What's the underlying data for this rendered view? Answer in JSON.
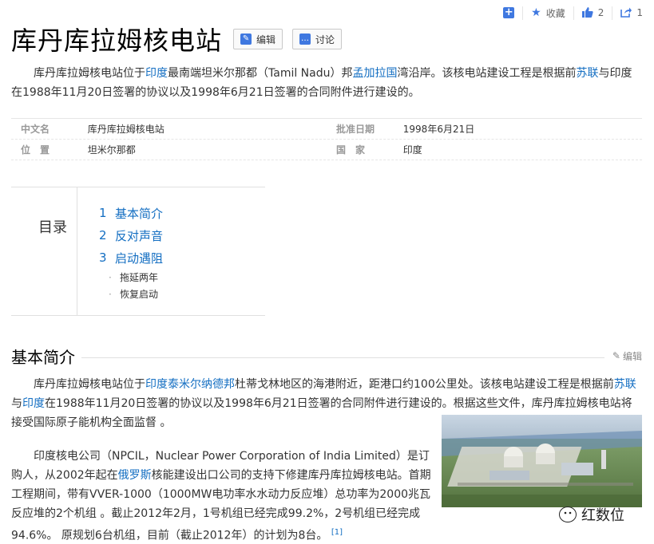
{
  "topbar": {
    "collect_label": "收藏",
    "like_count": "2",
    "share_count": "1"
  },
  "header": {
    "title": "库丹库拉姆核电站",
    "edit_label": "编辑",
    "discuss_label": "讨论"
  },
  "intro": {
    "s1": "库丹库拉姆核电站位于",
    "l1": "印度",
    "s2": "最南端坦米尔那都（Tamil Nadu）邦",
    "l2": "孟加拉国",
    "s3": "湾沿岸。该核电站建设工程是根据前",
    "l3": "苏联",
    "s4": "与印度在1988年11月20日签署的协议以及1998年6月21日签署的合同附件进行建设的。"
  },
  "basic_info": [
    {
      "n1": "中文名",
      "v1": "库丹库拉姆核电站",
      "n2": "批准日期",
      "v2": "1998年6月21日"
    },
    {
      "n1": "位　置",
      "v1": "坦米尔那都",
      "n2": "国　家",
      "v2": "印度"
    }
  ],
  "toc": {
    "title": "目录",
    "items": [
      {
        "num": "1",
        "label": "基本简介"
      },
      {
        "num": "2",
        "label": "反对声音"
      },
      {
        "num": "3",
        "label": "启动遇阻"
      }
    ],
    "subs": [
      "拖延两年",
      "恢复启动"
    ]
  },
  "section": {
    "title": "基本简介",
    "edit_label": "编辑"
  },
  "p2": {
    "s1": "库丹库拉姆核电站位于",
    "l1": "印度",
    "l2": "泰米尔纳德邦",
    "s2": "杜蒂戈林地区的海港附近，距港口约100公里处。该核电站建设工程是根据前",
    "l3": "苏联",
    "s3": "与",
    "l4": "印度",
    "s4": "在1988年11月20日签署的协议以及1998年6月21日签署的合同附件进行建设的。根据这些文件，库丹库拉姆核电站将接受国际原子能机构全面监督 。"
  },
  "p3": {
    "s1": "印度核电公司（NPCIL，Nuclear Power Corporation of India Limited）是订购人，从2002年起在",
    "l1": "俄罗斯",
    "s2": "核能建设出口公司的支持下修建库丹库拉姆核电站。首期工程期间，带有VVER-1000（1000MW电功率水水动力反应堆）总功率为2000兆瓦反应堆的2个机组 。截止2012年2月，1号机组已经完成99.2%，2号机组已经完成94.6%。 原规划6台机组，目前（截止2012年）的计划为8台。",
    "ref": "[1]"
  },
  "watermark": "红数位"
}
